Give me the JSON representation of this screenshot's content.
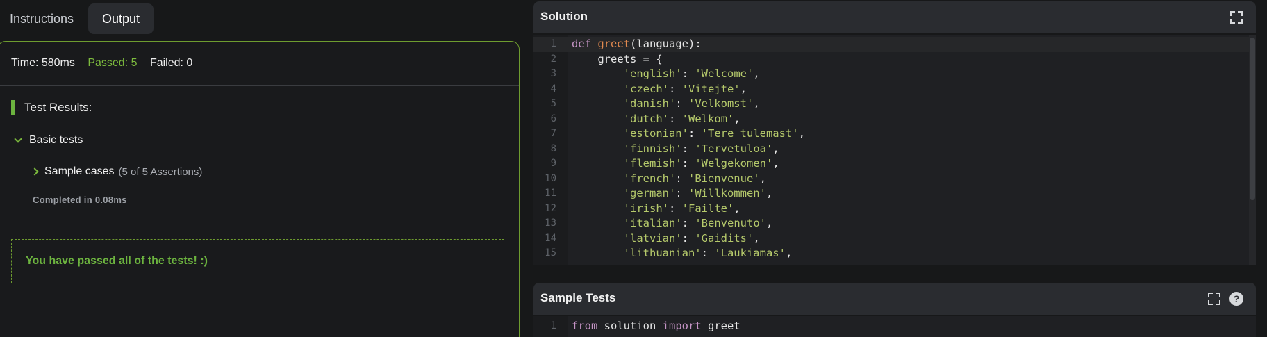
{
  "tabs": {
    "instructions": "Instructions",
    "output": "Output"
  },
  "output": {
    "time": "Time: 580ms",
    "passed": "Passed: 5",
    "failed": "Failed: 0",
    "test_results": "Test Results:",
    "group": "Basic tests",
    "case_label": "Sample cases",
    "case_assertions": "(5 of 5 Assertions)",
    "completed": "Completed in 0.08ms",
    "pass_message": "You have passed all of the tests! :)"
  },
  "solution": {
    "title": "Solution",
    "lines": [
      {
        "n": "1",
        "tokens": [
          {
            "t": "def ",
            "c": "kw"
          },
          {
            "t": "greet",
            "c": "fn"
          },
          {
            "t": "(language):",
            "c": ""
          }
        ]
      },
      {
        "n": "2",
        "tokens": [
          {
            "t": "    greets = {",
            "c": ""
          }
        ]
      },
      {
        "n": "3",
        "tokens": [
          {
            "t": "        ",
            "c": ""
          },
          {
            "t": "'english'",
            "c": "str"
          },
          {
            "t": ": ",
            "c": ""
          },
          {
            "t": "'Welcome'",
            "c": "str"
          },
          {
            "t": ",",
            "c": ""
          }
        ]
      },
      {
        "n": "4",
        "tokens": [
          {
            "t": "        ",
            "c": ""
          },
          {
            "t": "'czech'",
            "c": "str"
          },
          {
            "t": ": ",
            "c": ""
          },
          {
            "t": "'Vitejte'",
            "c": "str"
          },
          {
            "t": ",",
            "c": ""
          }
        ]
      },
      {
        "n": "5",
        "tokens": [
          {
            "t": "        ",
            "c": ""
          },
          {
            "t": "'danish'",
            "c": "str"
          },
          {
            "t": ": ",
            "c": ""
          },
          {
            "t": "'Velkomst'",
            "c": "str"
          },
          {
            "t": ",",
            "c": ""
          }
        ]
      },
      {
        "n": "6",
        "tokens": [
          {
            "t": "        ",
            "c": ""
          },
          {
            "t": "'dutch'",
            "c": "str"
          },
          {
            "t": ": ",
            "c": ""
          },
          {
            "t": "'Welkom'",
            "c": "str"
          },
          {
            "t": ",",
            "c": ""
          }
        ]
      },
      {
        "n": "7",
        "tokens": [
          {
            "t": "        ",
            "c": ""
          },
          {
            "t": "'estonian'",
            "c": "str"
          },
          {
            "t": ": ",
            "c": ""
          },
          {
            "t": "'Tere tulemast'",
            "c": "str"
          },
          {
            "t": ",",
            "c": ""
          }
        ]
      },
      {
        "n": "8",
        "tokens": [
          {
            "t": "        ",
            "c": ""
          },
          {
            "t": "'finnish'",
            "c": "str"
          },
          {
            "t": ": ",
            "c": ""
          },
          {
            "t": "'Tervetuloa'",
            "c": "str"
          },
          {
            "t": ",",
            "c": ""
          }
        ]
      },
      {
        "n": "9",
        "tokens": [
          {
            "t": "        ",
            "c": ""
          },
          {
            "t": "'flemish'",
            "c": "str"
          },
          {
            "t": ": ",
            "c": ""
          },
          {
            "t": "'Welgekomen'",
            "c": "str"
          },
          {
            "t": ",",
            "c": ""
          }
        ]
      },
      {
        "n": "10",
        "tokens": [
          {
            "t": "        ",
            "c": ""
          },
          {
            "t": "'french'",
            "c": "str"
          },
          {
            "t": ": ",
            "c": ""
          },
          {
            "t": "'Bienvenue'",
            "c": "str"
          },
          {
            "t": ",",
            "c": ""
          }
        ]
      },
      {
        "n": "11",
        "tokens": [
          {
            "t": "        ",
            "c": ""
          },
          {
            "t": "'german'",
            "c": "str"
          },
          {
            "t": ": ",
            "c": ""
          },
          {
            "t": "'Willkommen'",
            "c": "str"
          },
          {
            "t": ",",
            "c": ""
          }
        ]
      },
      {
        "n": "12",
        "tokens": [
          {
            "t": "        ",
            "c": ""
          },
          {
            "t": "'irish'",
            "c": "str"
          },
          {
            "t": ": ",
            "c": ""
          },
          {
            "t": "'Failte'",
            "c": "str"
          },
          {
            "t": ",",
            "c": ""
          }
        ]
      },
      {
        "n": "13",
        "tokens": [
          {
            "t": "        ",
            "c": ""
          },
          {
            "t": "'italian'",
            "c": "str"
          },
          {
            "t": ": ",
            "c": ""
          },
          {
            "t": "'Benvenuto'",
            "c": "str"
          },
          {
            "t": ",",
            "c": ""
          }
        ]
      },
      {
        "n": "14",
        "tokens": [
          {
            "t": "        ",
            "c": ""
          },
          {
            "t": "'latvian'",
            "c": "str"
          },
          {
            "t": ": ",
            "c": ""
          },
          {
            "t": "'Gaidits'",
            "c": "str"
          },
          {
            "t": ",",
            "c": ""
          }
        ]
      },
      {
        "n": "15",
        "tokens": [
          {
            "t": "        ",
            "c": ""
          },
          {
            "t": "'lithuanian'",
            "c": "str"
          },
          {
            "t": ": ",
            "c": ""
          },
          {
            "t": "'Laukiamas'",
            "c": "str"
          },
          {
            "t": ",",
            "c": ""
          }
        ]
      }
    ]
  },
  "sample_tests": {
    "title": "Sample Tests",
    "help": "?",
    "lines": [
      {
        "n": "1",
        "tokens": [
          {
            "t": "from",
            "c": "kw"
          },
          {
            "t": " solution ",
            "c": ""
          },
          {
            "t": "import",
            "c": "kw"
          },
          {
            "t": " greet",
            "c": ""
          }
        ]
      }
    ]
  },
  "icons": {
    "expand": "expand-icon",
    "help": "help-icon",
    "chevron_down": "chevron-down-icon",
    "chevron_right": "chevron-right-icon"
  },
  "colors": {
    "accent_green": "#6cb33f",
    "passed_text": "#7cba3d",
    "keyword": "#c594c5",
    "function": "#e1894f",
    "string": "#b5c96b"
  }
}
